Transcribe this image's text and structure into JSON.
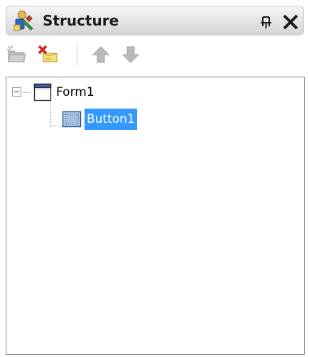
{
  "panel": {
    "title": "Structure",
    "title_icon": "structure-icon",
    "pin_icon": "pin-icon",
    "close_icon": "close-icon"
  },
  "toolbar": {
    "buttons": [
      {
        "name": "new-item-button",
        "icon": "new-folder-icon",
        "enabled": false
      },
      {
        "name": "delete-item-button",
        "icon": "delete-icon",
        "enabled": true
      },
      {
        "name": "move-up-button",
        "icon": "arrow-up-icon",
        "enabled": false
      },
      {
        "name": "move-down-button",
        "icon": "arrow-down-icon",
        "enabled": false
      }
    ]
  },
  "tree": {
    "nodes": [
      {
        "label": "Form1",
        "icon": "form-icon",
        "expanded": true,
        "children": [
          {
            "label": "Button1",
            "icon": "button-control-icon",
            "selected": true
          }
        ]
      }
    ]
  },
  "colors": {
    "selection": "#3399ff",
    "title_bar": "#e3e3e3",
    "border": "#828790",
    "close": "#1a1a1a"
  }
}
